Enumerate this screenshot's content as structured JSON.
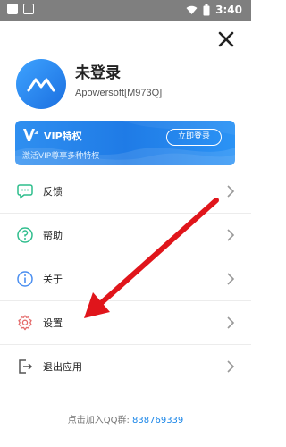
{
  "status_bar": {
    "time": "3:40"
  },
  "profile": {
    "name": "未登录",
    "id": "Apowersoft[M973Q]"
  },
  "vip": {
    "title": "VIP特权",
    "subtitle": "激活VIP尊享多种特权",
    "button_label": "立即登录"
  },
  "menu": {
    "items": [
      {
        "label": "反馈",
        "icon": "feedback-icon"
      },
      {
        "label": "帮助",
        "icon": "help-icon"
      },
      {
        "label": "关于",
        "icon": "info-icon"
      },
      {
        "label": "设置",
        "icon": "gear-icon"
      },
      {
        "label": "退出应用",
        "icon": "exit-icon"
      }
    ]
  },
  "footer": {
    "prefix": "点击加入QQ群: ",
    "qq_number": "838769339"
  },
  "colors": {
    "accent": "#1a86e8",
    "icon_green": "#2dbd8c",
    "icon_blue": "#4a8ef0",
    "icon_red": "#e46a6a",
    "annotation_arrow": "#e0151b"
  }
}
